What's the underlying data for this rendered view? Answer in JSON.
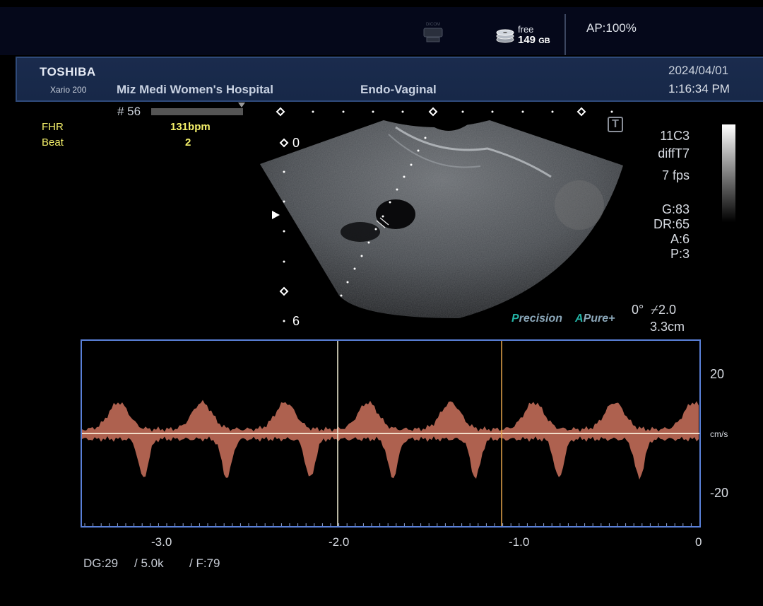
{
  "status_bar": {
    "dicom_label": "DICOM",
    "free_label": "free",
    "free_value": "149",
    "free_unit": "GB",
    "ap": "AP:100%"
  },
  "header": {
    "brand": "TOSHIBA",
    "model": "Xario 200",
    "hospital": "Miz Medi Women's Hospital",
    "preset": "Endo-Vaginal",
    "date": "2024/04/01",
    "time": "1:16:34 PM"
  },
  "frame": {
    "number": "# 56"
  },
  "measurements": {
    "fhr_label": "FHR",
    "fhr_value": "131bpm",
    "beat_label": "Beat",
    "beat_value": "2"
  },
  "bmode": {
    "depth_top": "0",
    "depth_bottom": "6",
    "transducer": "11C3",
    "mode": "diffT7",
    "fps": "7 fps",
    "gain": "G:83",
    "dynamic_range": "DR:65",
    "a": "A:6",
    "p": "P:3",
    "precision_p": "P",
    "precision_rest": "recision",
    "pure_a": "A",
    "pure_rest": "Pure+",
    "angle": "0°",
    "scale": "2.0",
    "depth_cm": "3.3cm",
    "t_marker": "T"
  },
  "doppler": {
    "velocity_ticks": [
      "20",
      "cm/s",
      "-20"
    ],
    "time_ticks": [
      "-3.0",
      "-2.0",
      "-1.0",
      "0"
    ],
    "dg": "DG:29",
    "prf": "/ 5.0k",
    "filter": "/ F:79",
    "colors": {
      "border": "#5a80d8",
      "spectrum": "#e8826a",
      "baseline": "#f2dcc8",
      "cursor1": "#f5f1d8",
      "cursor2": "#e6a64a"
    }
  }
}
